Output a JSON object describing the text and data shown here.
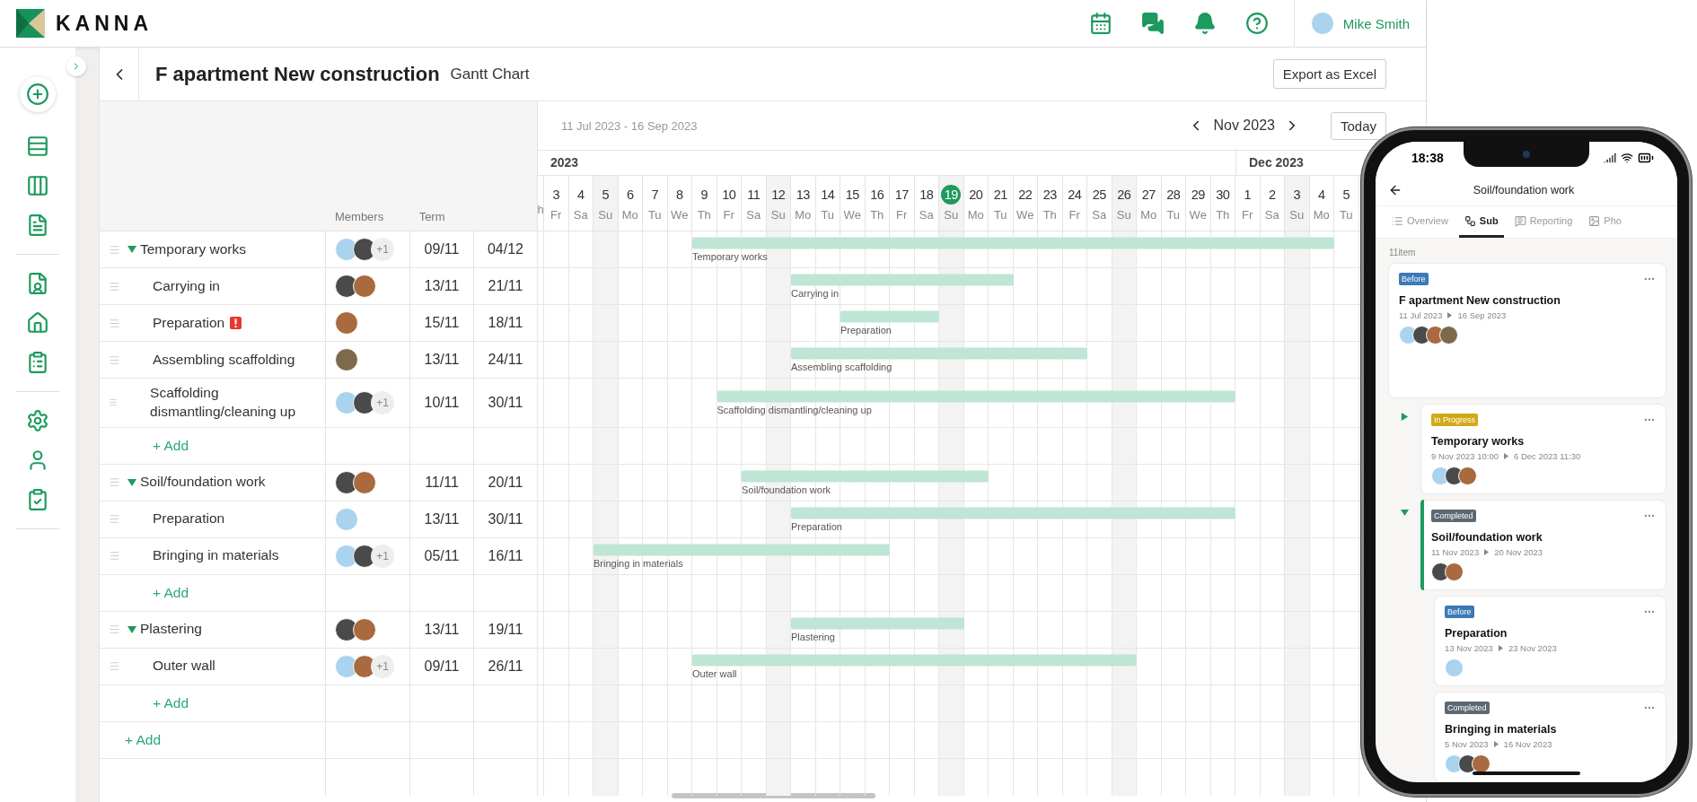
{
  "topbar": {
    "logo": "KANNA",
    "user": "Mike Smith"
  },
  "header": {
    "title": "F apartment New construction",
    "subtitle": "Gantt Chart",
    "export": "Export as Excel"
  },
  "gantt": {
    "range": "11 Jul 2023 - 16 Sep 2023",
    "month": "Nov 2023",
    "today_button": "Today",
    "columns": [
      "Members",
      "Term"
    ],
    "months": [
      {
        "label": "2023",
        "days": [
          {
            "weekday": "h",
            "partial": true,
            "weekend": false
          },
          {
            "day": "3",
            "weekday": "Fr",
            "partial": false,
            "weekend": false,
            "today": false
          },
          {
            "day": "4",
            "weekday": "Sa",
            "partial": false,
            "weekend": false,
            "today": false
          },
          {
            "day": "5",
            "weekday": "Su",
            "partial": false,
            "weekend": true,
            "today": false
          },
          {
            "day": "6",
            "weekday": "Mo",
            "partial": false,
            "weekend": false,
            "today": false
          },
          {
            "day": "7",
            "weekday": "Tu",
            "partial": false,
            "weekend": false,
            "today": false
          },
          {
            "day": "8",
            "weekday": "We",
            "partial": false,
            "weekend": false,
            "today": false
          },
          {
            "day": "9",
            "weekday": "Th",
            "partial": false,
            "weekend": false,
            "today": false
          },
          {
            "day": "10",
            "weekday": "Fr",
            "partial": false,
            "weekend": false,
            "today": false
          },
          {
            "day": "11",
            "weekday": "Sa",
            "partial": false,
            "weekend": false,
            "today": false
          },
          {
            "day": "12",
            "weekday": "Su",
            "partial": false,
            "weekend": true,
            "today": false
          },
          {
            "day": "13",
            "weekday": "Mo",
            "partial": false,
            "weekend": false,
            "today": false
          },
          {
            "day": "14",
            "weekday": "Tu",
            "partial": false,
            "weekend": false,
            "today": false
          },
          {
            "day": "15",
            "weekday": "We",
            "partial": false,
            "weekend": false,
            "today": false
          },
          {
            "day": "16",
            "weekday": "Th",
            "partial": false,
            "weekend": false,
            "today": false
          },
          {
            "day": "17",
            "weekday": "Fr",
            "partial": false,
            "weekend": false,
            "today": false
          },
          {
            "day": "18",
            "weekday": "Sa",
            "partial": false,
            "weekend": false,
            "today": false
          },
          {
            "day": "19",
            "weekday": "Su",
            "partial": false,
            "weekend": true,
            "today": true
          },
          {
            "day": "20",
            "weekday": "Mo",
            "partial": false,
            "weekend": false,
            "today": false
          },
          {
            "day": "21",
            "weekday": "Tu",
            "partial": false,
            "weekend": false,
            "today": false
          },
          {
            "day": "22",
            "weekday": "We",
            "partial": false,
            "weekend": false,
            "today": false
          },
          {
            "day": "23",
            "weekday": "Th",
            "partial": false,
            "weekend": false,
            "today": false
          },
          {
            "day": "24",
            "weekday": "Fr",
            "partial": false,
            "weekend": false,
            "today": false
          },
          {
            "day": "25",
            "weekday": "Sa",
            "partial": false,
            "weekend": false,
            "today": false
          },
          {
            "day": "26",
            "weekday": "Su",
            "partial": false,
            "weekend": true,
            "today": false
          },
          {
            "day": "27",
            "weekday": "Mo",
            "partial": false,
            "weekend": false,
            "today": false
          },
          {
            "day": "28",
            "weekday": "Tu",
            "partial": false,
            "weekend": false,
            "today": false
          },
          {
            "day": "29",
            "weekday": "We",
            "partial": false,
            "weekend": false,
            "today": false
          },
          {
            "day": "30",
            "weekday": "Th",
            "partial": false,
            "weekend": false,
            "today": false
          }
        ]
      },
      {
        "label": "Dec 2023",
        "days": [
          {
            "day": "1",
            "weekday": "Fr",
            "partial": false,
            "weekend": false,
            "today": false
          },
          {
            "day": "2",
            "weekday": "Sa",
            "partial": false,
            "weekend": false,
            "today": false
          },
          {
            "day": "3",
            "weekday": "Su",
            "partial": false,
            "weekend": true,
            "today": false
          },
          {
            "day": "4",
            "weekday": "Mo",
            "partial": false,
            "weekend": false,
            "today": false
          },
          {
            "day": "5",
            "weekday": "Tu",
            "partial": false,
            "weekend": false,
            "today": false
          }
        ]
      }
    ],
    "tasks": [
      {
        "name": "Temporary works",
        "expanded": true,
        "alert": false,
        "members": [
          {
            "kind": "cartoon"
          },
          {
            "kind": "dark"
          }
        ],
        "more": "+1",
        "start": "09/11",
        "end": "04/12",
        "bar_label": "Temporary works",
        "add": "+ Add",
        "children": [
          {
            "name": "Carrying in",
            "alert": false,
            "members": [
              {
                "kind": "dark"
              },
              {
                "kind": "warm"
              }
            ],
            "start": "13/11",
            "end": "21/11",
            "bar_label": "Carrying in"
          },
          {
            "name": "Preparation",
            "alert": true,
            "members": [
              {
                "kind": "warm"
              }
            ],
            "start": "15/11",
            "end": "18/11",
            "bar_label": "Preparation"
          },
          {
            "name": "Assembling scaffolding",
            "alert": false,
            "members": [
              {
                "kind": "portrait"
              }
            ],
            "start": "13/11",
            "end": "24/11",
            "bar_label": "Assembling scaffolding"
          },
          {
            "name": "Scaffolding dismantling/cleaning up",
            "alert": false,
            "members": [
              {
                "kind": "cartoon"
              },
              {
                "kind": "dark"
              }
            ],
            "more": "+1",
            "start": "10/11",
            "end": "30/11",
            "bar_label": "Scaffolding dismantling/cleaning up"
          }
        ]
      },
      {
        "name": "Soil/foundation work",
        "expanded": true,
        "alert": false,
        "members": [
          {
            "kind": "dark"
          },
          {
            "kind": "warm"
          }
        ],
        "start": "11/11",
        "end": "20/11",
        "bar_label": "Soil/foundation work",
        "add": "+ Add",
        "children": [
          {
            "name": "Preparation",
            "alert": false,
            "members": [
              {
                "kind": "cartoon"
              }
            ],
            "start": "13/11",
            "end": "30/11",
            "bar_label": "Preparation"
          },
          {
            "name": "Bringing in materials",
            "alert": false,
            "members": [
              {
                "kind": "cartoon"
              },
              {
                "kind": "dark"
              }
            ],
            "more": "+1",
            "start": "05/11",
            "end": "16/11",
            "bar_label": "Bringing in materials"
          }
        ]
      },
      {
        "name": "Plastering",
        "expanded": true,
        "alert": false,
        "members": [
          {
            "kind": "dark"
          },
          {
            "kind": "warm"
          }
        ],
        "start": "13/11",
        "end": "19/11",
        "bar_label": "Plastering",
        "add": "+ Add",
        "children": [
          {
            "name": "Outer wall",
            "alert": false,
            "members": [
              {
                "kind": "cartoon"
              },
              {
                "kind": "warm"
              }
            ],
            "more": "+1",
            "start": "09/11",
            "end": "26/11",
            "bar_label": "Outer wall"
          }
        ]
      }
    ],
    "add_label": "+ Add"
  },
  "phone": {
    "time": "18:38",
    "title": "Soil/foundation work",
    "tabs": [
      {
        "label": "Overview",
        "kind": "list",
        "selected": false
      },
      {
        "label": "Sub",
        "kind": "sub",
        "selected": true
      },
      {
        "label": "Reporting",
        "kind": "report",
        "selected": false
      },
      {
        "label": "Pho",
        "kind": "photo",
        "selected": false
      }
    ],
    "count": "11item",
    "card": {
      "status": "Before",
      "color": "#3c79b6",
      "title": "F apartment New construction",
      "start": "11 Jul 2023",
      "end": "16 Sep 2023",
      "members": [
        {
          "kind": "cartoon"
        },
        {
          "kind": "dark"
        },
        {
          "kind": "warm"
        },
        {
          "kind": "portrait"
        }
      ],
      "children": [
        {
          "status": "In Progress",
          "color": "#d2a914",
          "title": "Temporary works",
          "start": "9 Nov 2023 10:00",
          "end": "6 Dec 2023 11:30",
          "members": [
            {
              "kind": "cartoon"
            },
            {
              "kind": "dark"
            },
            {
              "kind": "warm"
            }
          ],
          "expanded": false,
          "selected": false
        },
        {
          "status": "Completed",
          "color": "#5d6874",
          "title": "Soil/foundation work",
          "start": "11 Nov 2023",
          "end": "20 Nov 2023",
          "members": [
            {
              "kind": "dark"
            },
            {
              "kind": "warm"
            }
          ],
          "expanded": true,
          "selected": true,
          "children": [
            {
              "status": "Before",
              "color": "#3c79b6",
              "title": "Preparation",
              "start": "13 Nov 2023",
              "end": "23 Nov 2023",
              "members": [
                {
                  "kind": "cartoon"
                }
              ]
            },
            {
              "status": "Completed",
              "color": "#5d6874",
              "title": "Bringing in materials",
              "start": "5 Nov 2023",
              "end": "16 Nov 2023",
              "members": [
                {
                  "kind": "cartoon"
                },
                {
                  "kind": "dark"
                },
                {
                  "kind": "warm"
                }
              ]
            }
          ]
        }
      ]
    }
  }
}
